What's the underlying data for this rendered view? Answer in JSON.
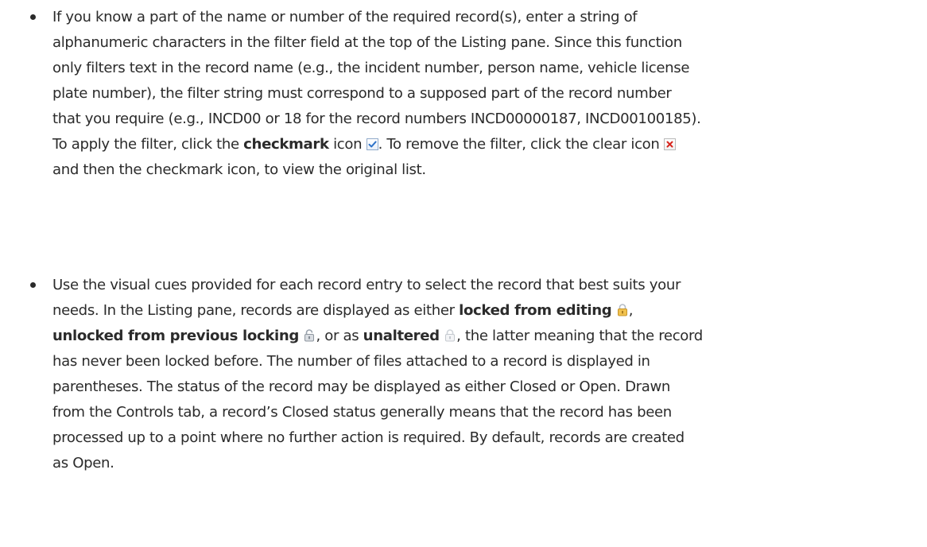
{
  "bullets": [
    {
      "lines": [
        {
          "t1": "If you know a part of the name or number of the required record(s), enter a string of"
        },
        {
          "t1": "alphanumeric characters in the filter field at the top of the Listing pane. Since this function"
        },
        {
          "t1": "only filters text in the record name (e.g., the incident number, person name, vehicle license"
        },
        {
          "t1": "plate number), the filter string must correspond to a supposed part of the record number"
        },
        {
          "t1": "that you require (e.g., INCD00 or 18 for the record numbers INCD00000187, INCD00100185)."
        },
        {
          "t1": "To apply the filter, click the ",
          "b1": "checkmark",
          "t2": " icon ",
          "t3": ". To remove the filter, click the clear icon "
        },
        {
          "t1": "and then the checkmark icon, to view the original list."
        }
      ]
    },
    {
      "lines": [
        {
          "t1": "Use the visual cues provided for each record entry to select the record that best suits your"
        },
        {
          "t1": "needs. In the Listing pane, records are displayed as either ",
          "b1": "locked from editing",
          "t2": ","
        },
        {
          "b1": "unlocked from previous locking",
          "t2": ", or as ",
          "b2": "unaltered",
          "t3": ", the latter meaning that the record"
        },
        {
          "t1": "has never been locked before. The number of files attached to a record is displayed in"
        },
        {
          "t1": "parentheses. The status of the record may be displayed as either Closed or Open. Drawn"
        },
        {
          "t1": "from the Controls tab, a record’s Closed status generally means that the record has been"
        },
        {
          "t1": "processed up to a point where no further action is required. By default, records are created"
        },
        {
          "t1": "as Open."
        }
      ]
    }
  ],
  "icons": {
    "checkmark": "checkmark-icon",
    "clear": "clear-icon",
    "locked": "locked-icon",
    "unlocked": "unlocked-icon",
    "unaltered": "unaltered-icon"
  },
  "colors": {
    "text": "#2b2b2b",
    "check": "#2f73c9",
    "clear": "#d7261e",
    "lock_gold": "#e9b53d"
  }
}
